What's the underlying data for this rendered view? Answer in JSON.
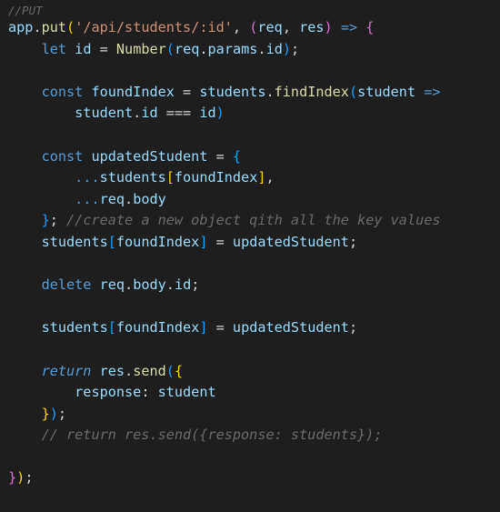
{
  "colors": {
    "background": "#1e1e1e",
    "comment": "#6a6a6a",
    "keyword": "#569cd6",
    "function": "#dcdcaa",
    "string": "#ce9178",
    "variable": "#9cdcfe",
    "plain": "#d4d4d4",
    "bracket_gold": "#ffd700",
    "bracket_orchid": "#da70d6",
    "bracket_blue": "#179fff"
  },
  "code": {
    "l1": {
      "comment": "//PUT"
    },
    "l2": {
      "app": "app",
      "dot": ".",
      "put": "put",
      "open": "(",
      "route": "'/api/students/:id'",
      "comma": ", ",
      "popen": "(",
      "req": "req",
      "sep": ", ",
      "res": "res",
      "pclose": ")",
      "arrow": " => ",
      "brace": "{"
    },
    "l3": {
      "indent": "    ",
      "let": "let",
      "sp": " ",
      "id": "id",
      "eq": " = ",
      "Number": "Number",
      "open": "(",
      "req": "req",
      "d1": ".",
      "params": "params",
      "d2": ".",
      "id2": "id",
      "close": ")",
      "semi": ";"
    },
    "l5": {
      "indent": "    ",
      "const": "const",
      "sp": " ",
      "foundIndex": "foundIndex",
      "eq": " = ",
      "students": "students",
      "dot": ".",
      "findIndex": "findIndex",
      "open": "(",
      "student": "student",
      "arrow": " =>"
    },
    "l6": {
      "indent": "        ",
      "student": "student",
      "dot": ".",
      "id": "id",
      "eqeq": " === ",
      "id2": "id",
      "close": ")"
    },
    "l8": {
      "indent": "    ",
      "const": "const",
      "sp": " ",
      "updatedStudent": "updatedStudent",
      "eq": " = ",
      "brace": "{"
    },
    "l9": {
      "indent": "        ",
      "spread": "...",
      "students": "students",
      "bopen": "[",
      "foundIndex": "foundIndex",
      "bclose": "]",
      "comma": ","
    },
    "l10": {
      "indent": "        ",
      "spread": "...",
      "req": "req",
      "dot": ".",
      "body": "body"
    },
    "l11": {
      "indent": "    ",
      "brace": "}",
      "semi": "; ",
      "comment": "//create a new object qith all the key values"
    },
    "l12": {
      "indent": "    ",
      "students": "students",
      "bopen": "[",
      "foundIndex": "foundIndex",
      "bclose": "]",
      "eq": " = ",
      "updatedStudent": "updatedStudent",
      "semi": ";"
    },
    "l14": {
      "indent": "    ",
      "delete": "delete",
      "sp": " ",
      "req": "req",
      "d1": ".",
      "body": "body",
      "d2": ".",
      "id": "id",
      "semi": ";"
    },
    "l16": {
      "indent": "    ",
      "students": "students",
      "bopen": "[",
      "foundIndex": "foundIndex",
      "bclose": "]",
      "eq": " = ",
      "updatedStudent": "updatedStudent",
      "semi": ";"
    },
    "l18": {
      "indent": "    ",
      "return": "return",
      "sp": " ",
      "res": "res",
      "dot": ".",
      "send": "send",
      "open": "(",
      "brace": "{"
    },
    "l19": {
      "indent": "        ",
      "response": "response",
      "colon": ": ",
      "student": "student"
    },
    "l20": {
      "indent": "    ",
      "brace": "}",
      "close": ")",
      "semi": ";"
    },
    "l21": {
      "indent": "    ",
      "comment": "// return res.send({response: students});"
    },
    "l23": {
      "brace": "}",
      "close": ")",
      "semi": ";"
    }
  }
}
